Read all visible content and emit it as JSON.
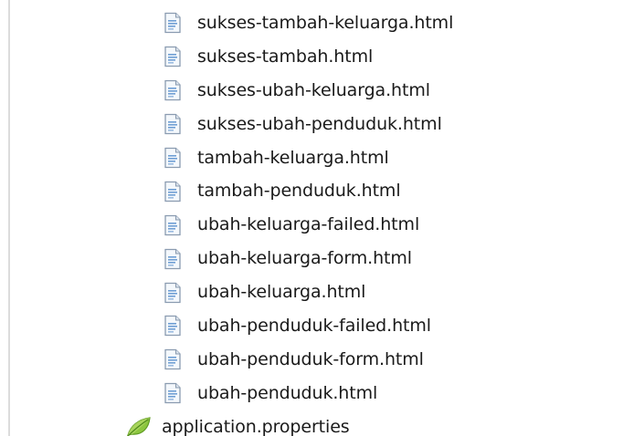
{
  "tree": {
    "items": [
      {
        "label": "sukses-tambah-keluarga.html",
        "icon": "html-file-icon"
      },
      {
        "label": "sukses-tambah.html",
        "icon": "html-file-icon"
      },
      {
        "label": "sukses-ubah-keluarga.html",
        "icon": "html-file-icon"
      },
      {
        "label": "sukses-ubah-penduduk.html",
        "icon": "html-file-icon"
      },
      {
        "label": "tambah-keluarga.html",
        "icon": "html-file-icon"
      },
      {
        "label": "tambah-penduduk.html",
        "icon": "html-file-icon"
      },
      {
        "label": "ubah-keluarga-failed.html",
        "icon": "html-file-icon"
      },
      {
        "label": "ubah-keluarga-form.html",
        "icon": "html-file-icon"
      },
      {
        "label": "ubah-keluarga.html",
        "icon": "html-file-icon"
      },
      {
        "label": "ubah-penduduk-failed.html",
        "icon": "html-file-icon"
      },
      {
        "label": "ubah-penduduk-form.html",
        "icon": "html-file-icon"
      },
      {
        "label": "ubah-penduduk.html",
        "icon": "html-file-icon"
      },
      {
        "label": "application.properties",
        "icon": "spring-leaf-icon"
      }
    ]
  },
  "colors": {
    "text": "#1a1a1a",
    "doc_border": "#8a9bb0",
    "doc_fill": "#f4f8fc",
    "leaf_green": "#7dbb3a"
  }
}
